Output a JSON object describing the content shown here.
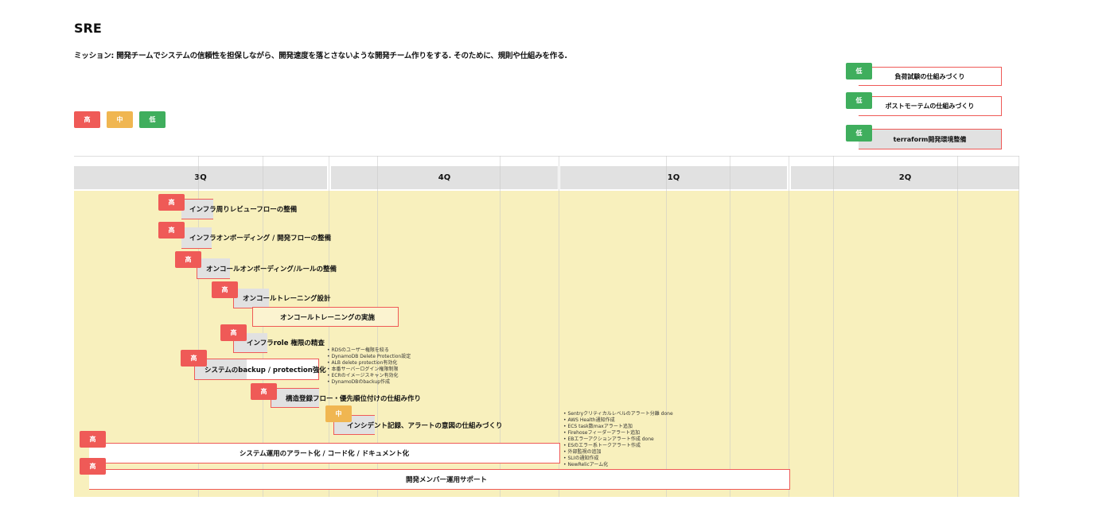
{
  "title": "SRE",
  "mission": "ミッション: 開発チームでシステムの信頼性を担保しながら、開発速度を落とさないような開発チーム作りをする. そのために、規則や仕組みを作る.",
  "legend": {
    "high": "高",
    "mid": "中",
    "low": "低"
  },
  "colors": {
    "high": "#ef5a57",
    "mid": "#f0b651",
    "low": "#3fae5d",
    "timeline_bg": "#f8f0bd",
    "header_bg": "#e1e1e1"
  },
  "top_tasks": [
    {
      "priority": "低",
      "label": "負荷試験の仕組みづくり"
    },
    {
      "priority": "低",
      "label": "ポストモーテムの仕組みづくり"
    },
    {
      "priority": "低",
      "label": "terraform開発環境整備"
    }
  ],
  "columns": [
    "3Q",
    "4Q",
    "1Q",
    "2Q"
  ],
  "tasks": [
    {
      "priority": "高",
      "label": "インフラ周りレビューフローの整備"
    },
    {
      "priority": "高",
      "label": "インフラオンボーディング / 開発フローの整備"
    },
    {
      "priority": "高",
      "label": "オンコールオンボーディング/ルールの整備"
    },
    {
      "priority": "高",
      "label": "オンコールトレーニング設計"
    },
    {
      "priority": "",
      "label": "オンコールトレーニングの実施"
    },
    {
      "priority": "高",
      "label": "インフラrole 権限の精査"
    },
    {
      "priority": "高",
      "label": "システムのbackup / protection強化"
    },
    {
      "priority": "高",
      "label": "構造登録フロー・優先順位付けの仕組み作り"
    },
    {
      "priority": "中",
      "label": "インシデント記録、アラートの意図の仕組みづくり"
    },
    {
      "priority": "高",
      "label": "システム運用のアラート化 / コード化 / ドキュメント化"
    },
    {
      "priority": "高",
      "label": "開発メンバー運用サポート"
    }
  ],
  "notes_backup": [
    "RDSのユーザー権限を絞る",
    "DynamoDB Delete Protection設定",
    "ALB delete protection有効化",
    "本番サーバーログイン権限制限",
    "ECRのイメージスキャン有効化",
    "DynamoDBのbackup作成"
  ],
  "notes_alert": [
    "Sentryクリティカルレベルのアラート分離 done",
    "AWS Health通知作成",
    "ECS task数maxアラート追加",
    "Firehoseフィーダーアラート追加",
    "EBエラーアクションアラート作成 done",
    "ESのエラー系トークアラート作成",
    "外部監視の追加",
    "SLIの通知作成",
    "NewRelicアーム化"
  ]
}
